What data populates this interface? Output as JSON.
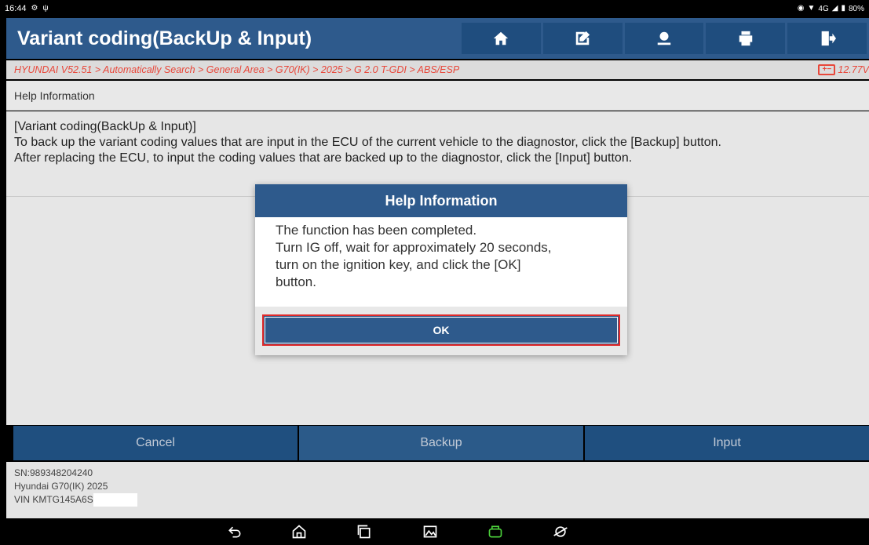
{
  "status_bar": {
    "time": "16:44",
    "battery": "80%",
    "network": "4G"
  },
  "header": {
    "title": "Variant coding(BackUp & Input)",
    "buttons": [
      "home-icon",
      "edit-report-icon",
      "profile-icon",
      "print-icon",
      "exit-icon"
    ]
  },
  "breadcrumb": {
    "path": "HYUNDAI V52.51 > Automatically Search > General Area > G70(IK) > 2025 > G 2.0 T-GDI > ABS/ESP",
    "voltage": "12.77V"
  },
  "help_section": {
    "header": "Help Information",
    "lines": [
      "[Variant coding(BackUp & Input)]",
      "To back up the variant coding values that are input in the ECU of the current vehicle to the diagnostor, click the [Backup] button.",
      "After replacing the ECU, to input the coding values that are backed up to the diagnostor, click the [Input] button."
    ]
  },
  "actions": {
    "cancel": "Cancel",
    "backup": "Backup",
    "input": "Input"
  },
  "footer": {
    "sn": "SN:989348204240",
    "vehicle": "Hyundai G70(IK) 2025",
    "vin": "VIN KMTG145A6S"
  },
  "dialog": {
    "title": "Help Information",
    "lines": [
      "The function has been completed.",
      "Turn IG off, wait for approximately 20 seconds,",
      "turn on the ignition key, and click the [OK]",
      "button."
    ],
    "ok_label": "OK"
  },
  "colors": {
    "primary": "#2e5a8c",
    "breadcrumb_text": "#e8473a",
    "highlight": "#e02a2a"
  }
}
